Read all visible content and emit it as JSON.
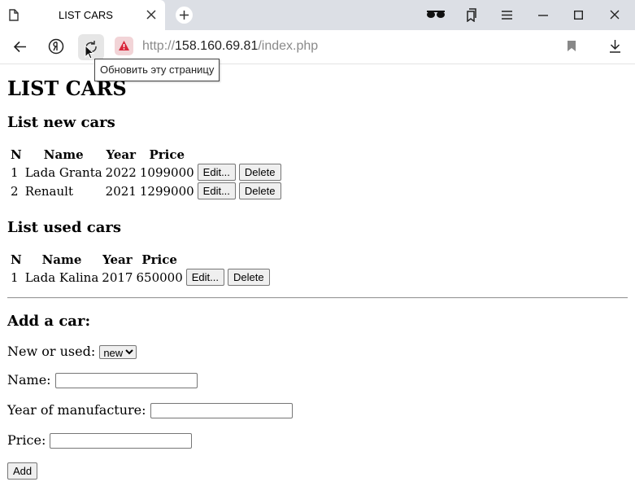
{
  "browser": {
    "tab_title": "LIST CARS",
    "url_scheme": "http://",
    "url_host": "158.160.69.81",
    "url_path": "/index.php",
    "tooltip": "Обновить эту страницу"
  },
  "page": {
    "title": "LIST CARS",
    "new_heading": "List new cars",
    "used_heading": "List used cars",
    "columns": [
      "N",
      "Name",
      "Year",
      "Price"
    ],
    "new_cars": [
      {
        "n": "1",
        "name": "Lada Granta",
        "year": "2022",
        "price": "1099000"
      },
      {
        "n": "2",
        "name": "Renault",
        "year": "2021",
        "price": "1299000"
      }
    ],
    "used_cars": [
      {
        "n": "1",
        "name": "Lada Kalina",
        "year": "2017",
        "price": "650000"
      }
    ],
    "edit_label": "Edit...",
    "delete_label": "Delete",
    "add_heading": "Add a car:",
    "new_or_used_label": "New or used:",
    "new_or_used_value": "new",
    "name_label": "Name:",
    "year_label": "Year of manufacture:",
    "price_label": "Price:",
    "add_button": "Add"
  }
}
